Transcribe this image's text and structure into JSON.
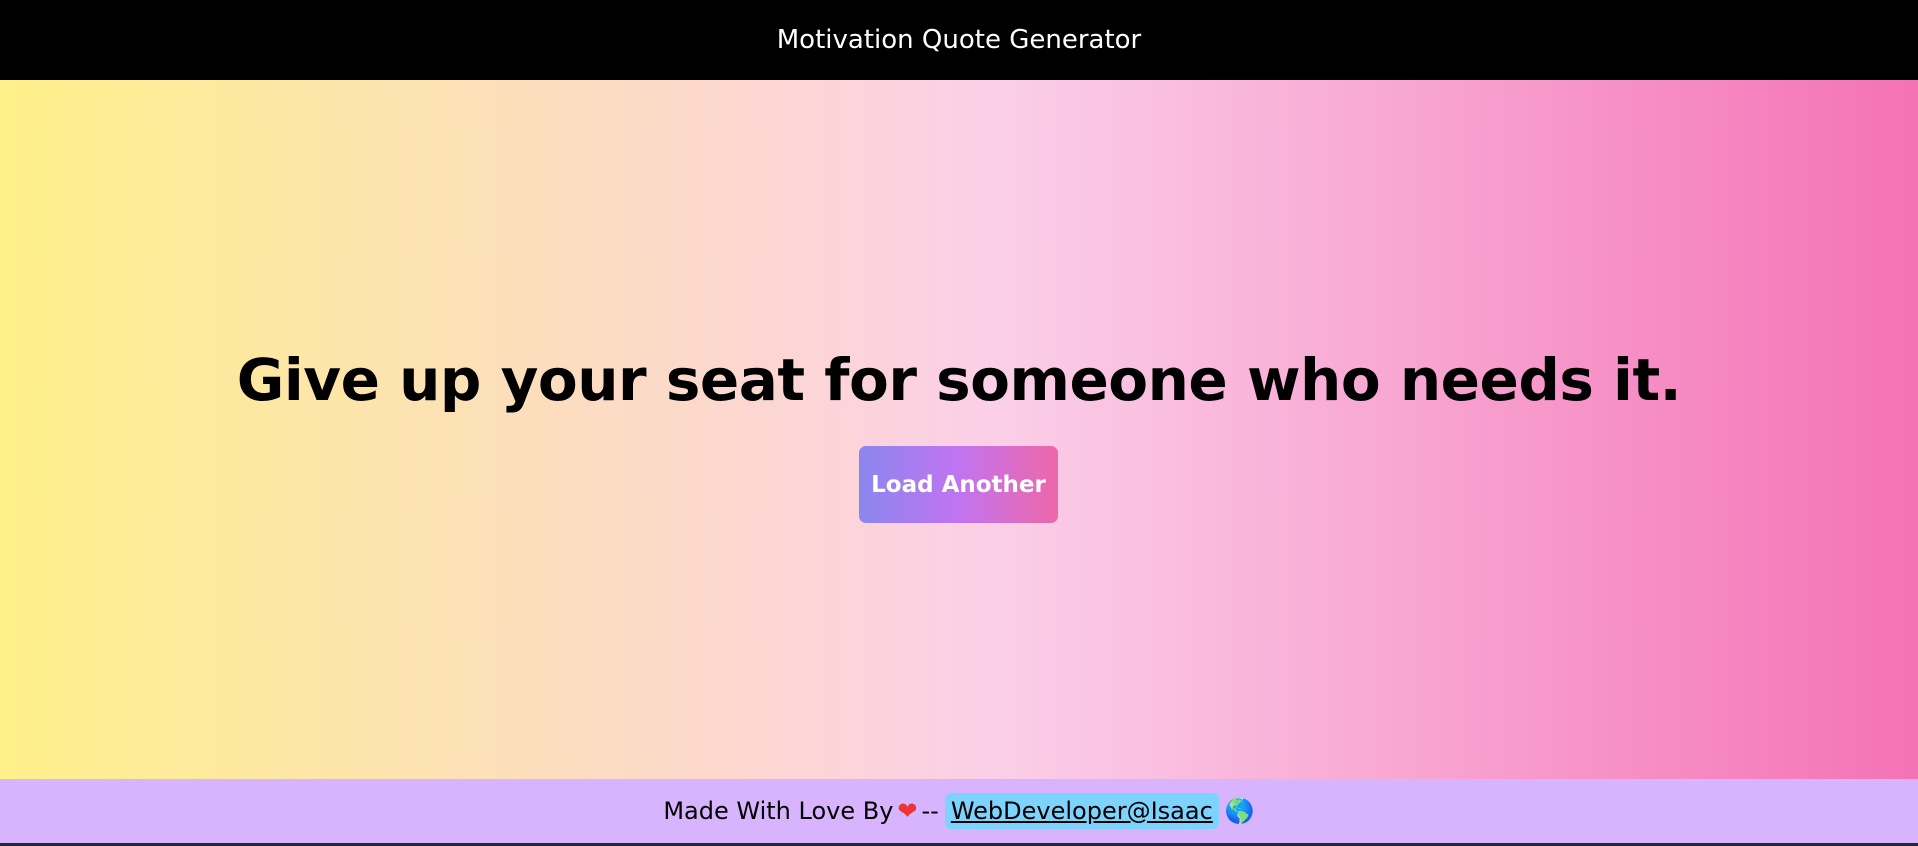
{
  "header": {
    "title": "Motivation Quote Generator"
  },
  "main": {
    "quote": "Give up your seat for someone who needs it.",
    "button_label": "Load Another"
  },
  "footer": {
    "text": "Made With Love By",
    "heart": "❤",
    "separator": "--",
    "link_text": "WebDeveloper@Isaac",
    "globe": "🌎"
  },
  "colors": {
    "gradient_start": "#fef08a",
    "gradient_mid": "#fbcfe8",
    "gradient_end": "#f472b6",
    "footer_bg": "#d8b4fe",
    "link_bg": "#7dd3fc"
  }
}
